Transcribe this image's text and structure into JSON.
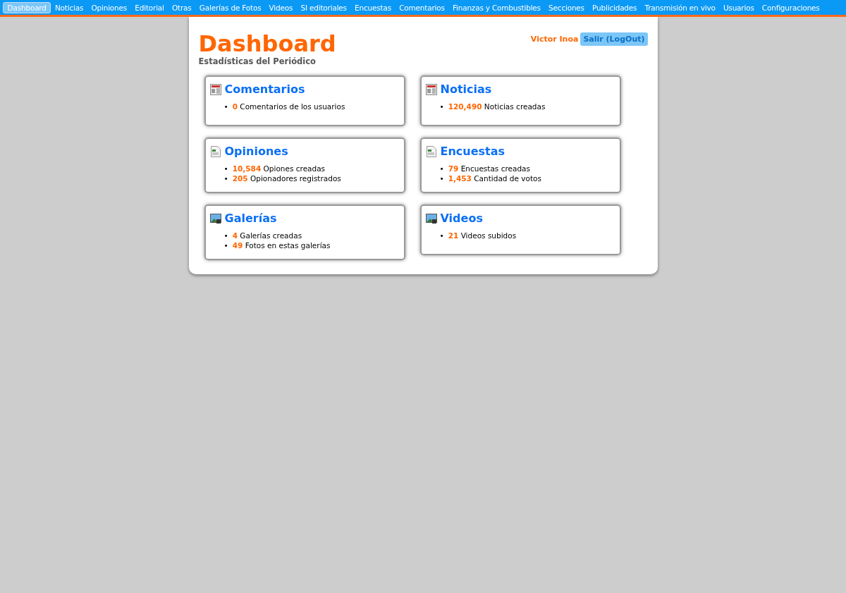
{
  "nav": [
    {
      "label": "Dashboard",
      "selected": true
    },
    {
      "label": "Noticias",
      "selected": false
    },
    {
      "label": "Opiniones",
      "selected": false
    },
    {
      "label": "Editorial",
      "selected": false
    },
    {
      "label": "Otras",
      "selected": false
    },
    {
      "label": "Galerías de Fotos",
      "selected": false
    },
    {
      "label": "Videos",
      "selected": false
    },
    {
      "label": "SI editoriales",
      "selected": false
    },
    {
      "label": "Encuestas",
      "selected": false
    },
    {
      "label": "Comentarios",
      "selected": false
    },
    {
      "label": "Finanzas y Combustibles",
      "selected": false
    },
    {
      "label": "Secciones",
      "selected": false
    },
    {
      "label": "Publicidades",
      "selected": false
    },
    {
      "label": "Transmisión en vivo",
      "selected": false
    },
    {
      "label": "Usuarios",
      "selected": false
    },
    {
      "label": "Configuraciones",
      "selected": false
    }
  ],
  "header": {
    "title": "Dashboard",
    "subtitle": "Estadísticas del Periódico",
    "user": "Victor Inoa",
    "logout": "Salir (LogOut)"
  },
  "cards": [
    {
      "title": "Comentarios",
      "kind": "newspaper",
      "stats": [
        {
          "bullet": "•",
          "text": "**0** Comentarios de los usuarios"
        }
      ]
    },
    {
      "title": "Noticias",
      "kind": "newspaper",
      "stats": [
        {
          "bullet": "•",
          "text": "**120,490** Noticias creadas"
        }
      ]
    },
    {
      "title": "Opiniones",
      "kind": "document",
      "stats": [
        {
          "bullet": "•",
          "text": "**10,584** Opiones creadas"
        },
        {
          "bullet": "•",
          "text": "**205** Opionadores registrados"
        }
      ]
    },
    {
      "title": "Encuestas",
      "kind": "document",
      "stats": [
        {
          "bullet": "•",
          "text": "**79** Encuestas creadas"
        },
        {
          "bullet": "•",
          "text": "**1,453** Cantidad de votos"
        }
      ]
    },
    {
      "title": "Galerías",
      "kind": "picture",
      "stats": [
        {
          "bullet": "•",
          "text": "**4** Galerías creadas"
        },
        {
          "bullet": "•",
          "text": "**49** Fotos en estas galerías"
        }
      ]
    },
    {
      "title": "Videos",
      "kind": "picture",
      "stats": [
        {
          "bullet": "•",
          "text": "**21** Videos subidos"
        }
      ]
    }
  ]
}
